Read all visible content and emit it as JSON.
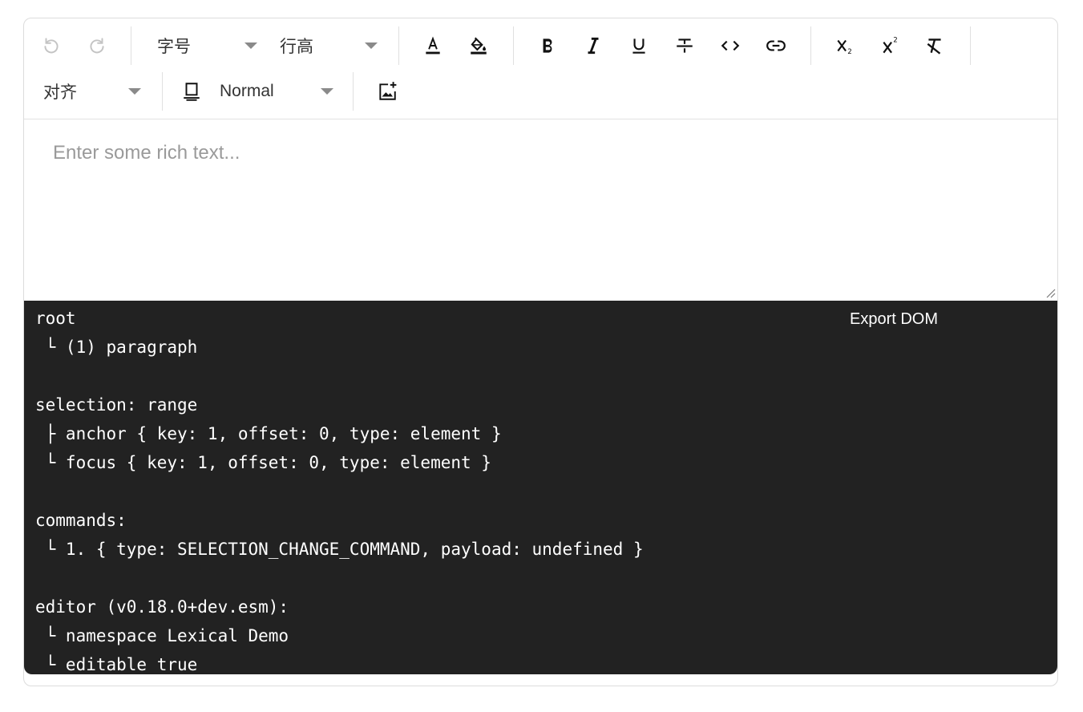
{
  "toolbar": {
    "undo_icon": "undo-icon",
    "redo_icon": "redo-icon",
    "font_size_label": "字号",
    "line_height_label": "行高",
    "text_color_icon": "font-color-icon",
    "bg_color_icon": "paint-bucket-icon",
    "bold_icon": "bold-icon",
    "italic_icon": "italic-icon",
    "underline_icon": "underline-icon",
    "strikethrough_icon": "strikethrough-icon",
    "code_icon": "code-icon",
    "link_icon": "link-icon",
    "subscript_icon": "subscript-icon",
    "superscript_icon": "superscript-icon",
    "clear_format_icon": "clear-format-icon",
    "align_label": "对齐",
    "block_type_icon": "block-type-icon",
    "block_type_value": "Normal",
    "insert_image_icon": "insert-image-icon",
    "accent_color": "#000000",
    "disabled_color": "#bbbbbb"
  },
  "editor": {
    "placeholder": "Enter some rich text..."
  },
  "debug": {
    "export_label": "Export DOM",
    "background": "#222222",
    "lines": [
      "root",
      " └ (1) paragraph",
      "",
      "selection: range",
      " ├ anchor { key: 1, offset: 0, type: element }",
      " └ focus { key: 1, offset: 0, type: element }",
      "",
      "commands:",
      " └ 1. { type: SELECTION_CHANGE_COMMAND, payload: undefined }",
      "",
      "editor (v0.18.0+dev.esm):",
      " └ namespace Lexical Demo",
      " └ editable true"
    ]
  }
}
